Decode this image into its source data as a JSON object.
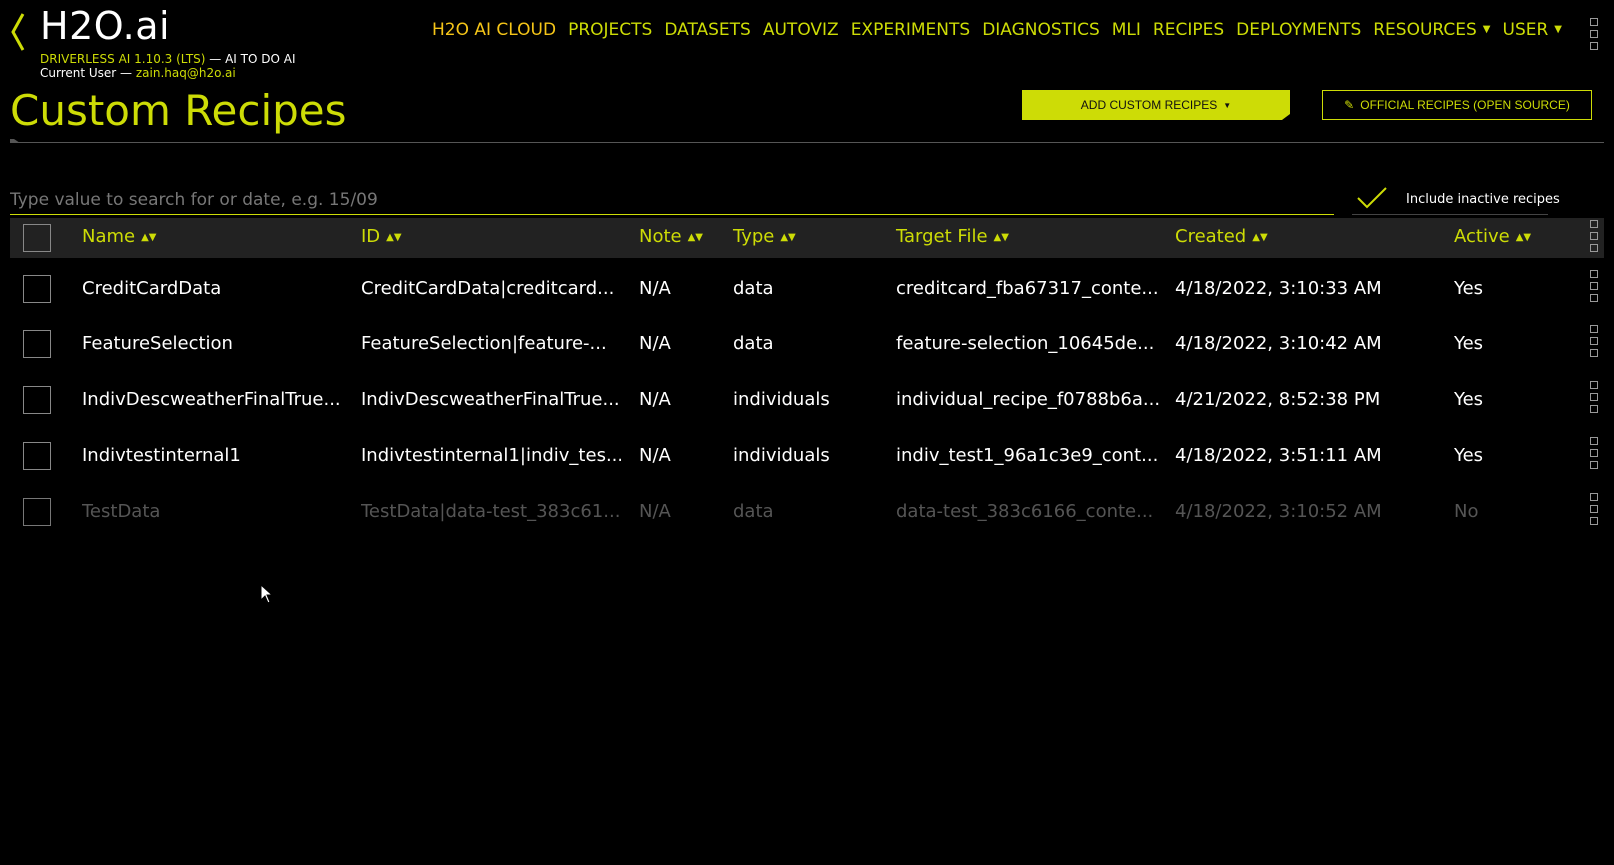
{
  "brand": {
    "name": "H2O.ai",
    "product": "DRIVERLESS AI 1.10.3 (LTS)",
    "tagline": " — AI TO DO AI",
    "user_prefix": "Current User — ",
    "user_email": "zain.haq@h2o.ai"
  },
  "nav": {
    "items": [
      {
        "label": "H2O AI CLOUD"
      },
      {
        "label": "PROJECTS"
      },
      {
        "label": "DATASETS"
      },
      {
        "label": "AUTOVIZ"
      },
      {
        "label": "EXPERIMENTS"
      },
      {
        "label": "DIAGNOSTICS"
      },
      {
        "label": "MLI"
      },
      {
        "label": "RECIPES"
      },
      {
        "label": "DEPLOYMENTS"
      },
      {
        "label": "RESOURCES"
      },
      {
        "label": "USER"
      }
    ]
  },
  "page": {
    "title": "Custom Recipes",
    "add_button": "ADD CUSTOM RECIPES",
    "official_button": "OFFICIAL RECIPES (OPEN SOURCE)"
  },
  "search": {
    "placeholder": "Type value to search for or date, e.g. 15/09",
    "include_inactive_label": "Include inactive recipes"
  },
  "table": {
    "columns": [
      "Name",
      "ID",
      "Note",
      "Type",
      "Target File",
      "Created",
      "Active"
    ],
    "rows": [
      {
        "name": "CreditCardData",
        "id": "CreditCardData|creditcard...",
        "note": "N/A",
        "type": "data",
        "file": "creditcard_fba67317_conte...",
        "created": "4/18/2022, 3:10:33 AM",
        "active": "Yes"
      },
      {
        "name": "FeatureSelection",
        "id": "FeatureSelection|feature-...",
        "note": "N/A",
        "type": "data",
        "file": "feature-selection_10645de...",
        "created": "4/18/2022, 3:10:42 AM",
        "active": "Yes"
      },
      {
        "name": "IndivDescweatherFinalTrue...",
        "id": "IndivDescweatherFinalTrue...",
        "note": "N/A",
        "type": "individuals",
        "file": "individual_recipe_f0788b6a...",
        "created": "4/21/2022, 8:52:38 PM",
        "active": "Yes"
      },
      {
        "name": "Indivtestinternal1",
        "id": "Indivtestinternal1|indiv_tes...",
        "note": "N/A",
        "type": "individuals",
        "file": "indiv_test1_96a1c3e9_cont...",
        "created": "4/18/2022, 3:51:11 AM",
        "active": "Yes"
      },
      {
        "name": "TestData",
        "id": "TestData|data-test_383c61...",
        "note": "N/A",
        "type": "data",
        "file": "data-test_383c6166_conte...",
        "created": "4/18/2022, 3:10:52 AM",
        "active": "No"
      }
    ]
  },
  "colors": {
    "accent": "#cddc06",
    "cloud": "#f5c518",
    "background": "#000000"
  }
}
